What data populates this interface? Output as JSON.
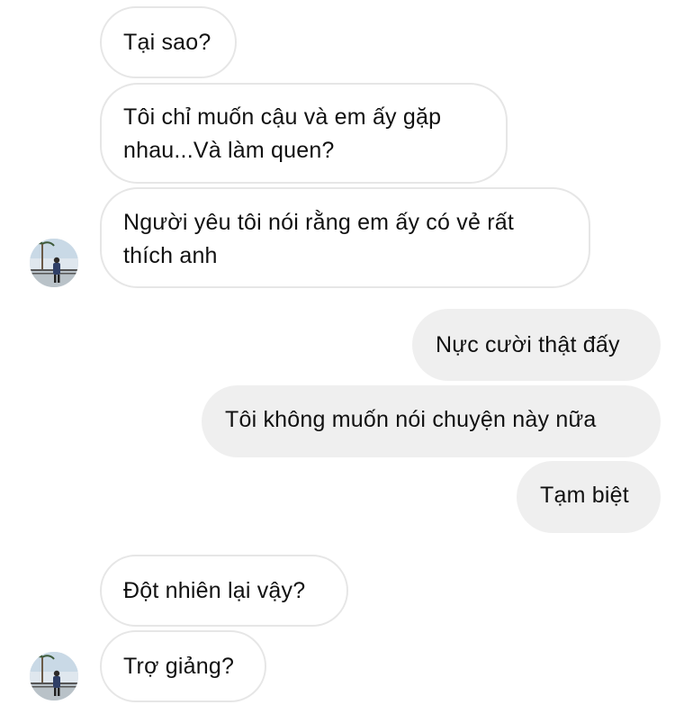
{
  "conversation": {
    "messages": [
      {
        "side": "in",
        "text": "Tại sao?"
      },
      {
        "side": "in",
        "line1": "Tôi chỉ muốn cậu và em ấy gặp",
        "line2": "nhau...Và làm quen?"
      },
      {
        "side": "in",
        "line1": "Người yêu tôi nói rằng em ấy có vẻ rất",
        "line2": "thích anh"
      },
      {
        "side": "out",
        "text": "Nực cười thật đấy"
      },
      {
        "side": "out",
        "text": "Tôi không muốn nói chuyện này nữa"
      },
      {
        "side": "out",
        "text": "Tạm biệt"
      },
      {
        "side": "in",
        "text": "Đột nhiên lại vậy?"
      },
      {
        "side": "in",
        "text": "Trợ giảng?"
      }
    ]
  },
  "colors": {
    "incoming_border": "#e6e6e6",
    "outgoing_bg": "#efefef",
    "text": "#111111"
  },
  "icons": {
    "contact_avatar": "avatar-photo-icon"
  }
}
